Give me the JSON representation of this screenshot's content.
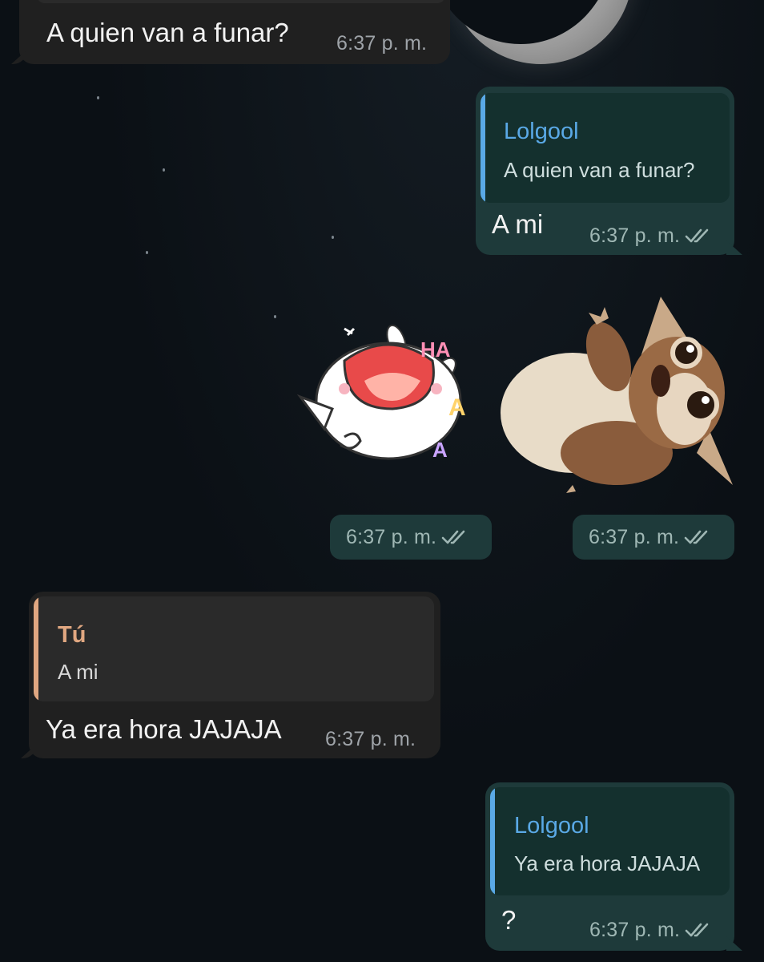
{
  "messages": [
    {
      "type": "incoming",
      "text": "A quien van a funar?",
      "time": "6:37 p. m."
    },
    {
      "type": "outgoing",
      "reply_to": {
        "name": "Lolgool",
        "text": "A quien van a funar?"
      },
      "text": "A mi",
      "time": "6:37 p. m."
    },
    {
      "type": "sticker",
      "sticker": "laughing-bunny",
      "sticker_text": [
        "HA",
        "A",
        "A"
      ],
      "time": "6:37 p. m."
    },
    {
      "type": "sticker",
      "sticker": "gizmo-plush",
      "time": "6:37 p. m."
    },
    {
      "type": "incoming",
      "reply_to": {
        "name": "Tú",
        "text": "A mi"
      },
      "text": "Ya era hora JAJAJA",
      "time": "6:37 p. m."
    },
    {
      "type": "outgoing",
      "reply_to": {
        "name": "Lolgool",
        "text": "Ya era hora JAJAJA"
      },
      "text": "?",
      "time": "6:37 p. m."
    }
  ],
  "colors": {
    "outgoing_bubble": "#1e3a3a",
    "incoming_bubble": "#202020",
    "reply_name_outgoing": "#5aa9e6",
    "reply_name_incoming": "#e0a781",
    "background": "#0b1015"
  },
  "icons": {
    "read_receipt": "double-check-icon"
  }
}
